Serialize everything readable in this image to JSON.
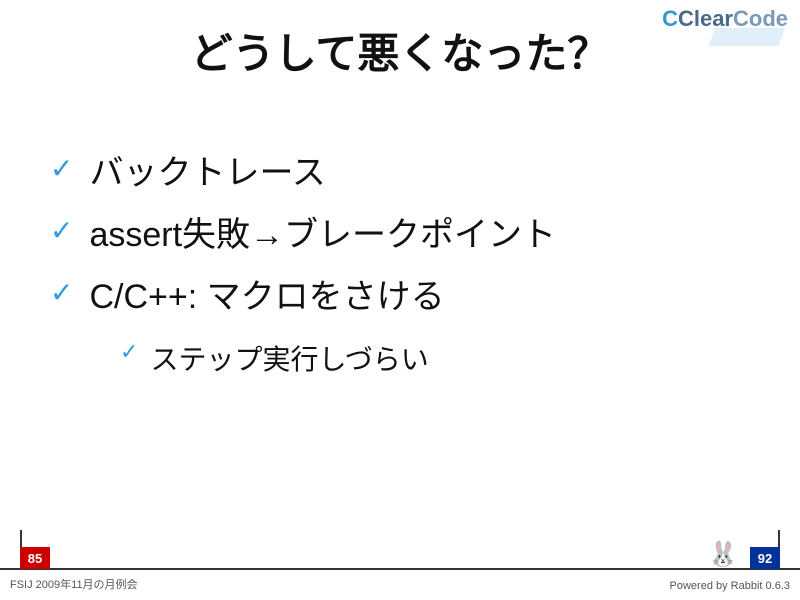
{
  "logo": {
    "c": "C",
    "clear": "Clear",
    "code": "Code"
  },
  "title": "どうして悪くなった？",
  "bullets": [
    {
      "text": "バックトレース"
    },
    {
      "text": "assert失敗→ブレークポイント"
    },
    {
      "text": "C/C++: マクロをさける",
      "sub": "ステップ実行しづらい"
    }
  ],
  "flags": {
    "left": "85",
    "right": "92"
  },
  "footer": {
    "left": "FSIJ 2009年11月の月例会",
    "right": "Powered by Rabbit 0.6.3"
  },
  "checkmark": "✓"
}
